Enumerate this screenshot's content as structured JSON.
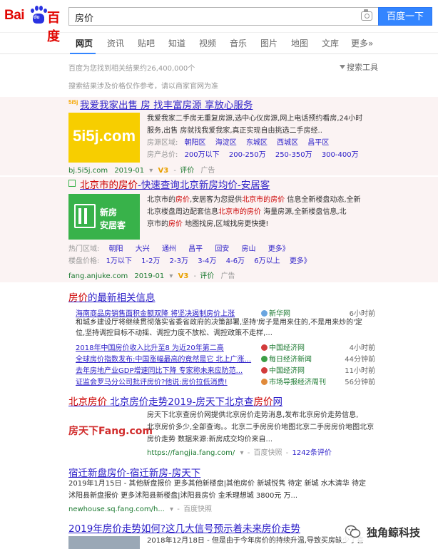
{
  "header": {
    "logo": {
      "bai": "Bai",
      "du": "du",
      "baike": "百度"
    },
    "search_value": "房价",
    "search_button": "百度一下"
  },
  "tabs": [
    "网页",
    "资讯",
    "贴吧",
    "知道",
    "视频",
    "音乐",
    "图片",
    "地图",
    "文库",
    "更多»"
  ],
  "meta": {
    "count": "百度为您找到相关结果约26,400,000个",
    "tools": "搜索工具",
    "notice": "搜索结果涉及价格仅作参考，请以商家官网为准"
  },
  "results": {
    "r1": {
      "title": "我爱我家出售 房 找丰富房源 享放心服务",
      "logo_badge": "5i5j",
      "thumb_text": "5i5j.com",
      "desc1": "我爱我家二手房无重复房源,选中心仪房源,网上电话预约看房,24小时",
      "desc2": "服务,出售 房就找我爱我家,真正实现自由挑选二手房经..",
      "area_label": "房源区域:",
      "areas": [
        "朝阳区",
        "海淀区",
        "东城区",
        "西城区",
        "昌平区"
      ],
      "price_label": "房产总价:",
      "prices": [
        "200万以下",
        "200-250万",
        "250-350万",
        "300-400万"
      ],
      "url": "bj.5i5j.com",
      "date": "2019-01",
      "v3": "V3",
      "comment": "评价",
      "ad": "广告"
    },
    "r2": {
      "title_a": "北京市的",
      "title_b": "房价",
      "title_c": "-快速查询北京新房均价-安居客",
      "thumb_text_1": "新房",
      "thumb_text_2": "安居客",
      "desc1_a": "北京市的",
      "desc1_b": "房价",
      "desc1_c": ",安居客为您提供",
      "desc1_d": "北京市的",
      "desc1_e": "房价",
      "desc1_f": " 信息全新楼盘动态,全新",
      "desc2_a": "北京楼盘周边配套信息",
      "desc2_b": "北京市的",
      "desc2_c": "房价",
      "desc2_d": " 海量房源,全新楼盘信息,北",
      "desc3_a": "京市的",
      "desc3_b": "房价",
      "desc3_c": " 地图找房,区域找房更快捷!",
      "hot_label": "热门区域:",
      "hot": [
        "朝阳",
        "大兴",
        "通州",
        "昌平",
        "回安",
        "房山",
        "更多》"
      ],
      "price_label": "楼盘价格:",
      "prices": [
        "1万以下",
        "1-2万",
        "2-3万",
        "3-4万",
        "4-6万",
        "6万以上",
        "更多》"
      ],
      "url": "fang.anjuke.com",
      "date": "2019-01",
      "v3": "V3",
      "comment": "评价",
      "ad": "广告"
    },
    "news": {
      "title_a": "房价",
      "title_b": "的最新相关信息",
      "row1": {
        "title": "海南商品房销售面积金额双降 将坚决遏制房价上涨",
        "src": "新华网",
        "time": "6小时前"
      },
      "snippet1": "和城乡建设厅将继续贯彻落实省委省政府的决策部署,坚持'房子是用来住的,不是用来炒的'定",
      "snippet2": "位,坚持调控目标不动摇、调控力度不放松、调控政策不走样,...",
      "row2": {
        "title": "2018年中国房价收入比升至8 为近20年第二高",
        "src": "中国经济网",
        "time": "4小时前"
      },
      "row3": {
        "title": "全球房价指数发布:中国涨幅最高的竟然是它 北上广涨...",
        "src": "每日经济新闻",
        "time": "44分钟前"
      },
      "row4": {
        "title": "去年房地产业GDP增速同比下降 专家称未来应防范...",
        "src": "中国经济网",
        "time": "11小时前"
      },
      "row5": {
        "title": "证监会罗马分公司批评房价?他说:房价拉低消费!",
        "src": "市场导报经济周刊",
        "time": "56分钟前"
      }
    },
    "r3": {
      "title_a": "北京房价",
      "title_b": " 北京房价走势2019-房天下北京查",
      "title_c": "房价",
      "title_d": "网",
      "thumb_text": "房天下Fang.com",
      "desc1": "房天下北京查房价网提供北京房价走势消息,发布北京房价走势信息,",
      "desc2": "北京房价多少,全部查询。。北京二手房房价地图北京二手房房价地图北京",
      "desc3": "房价走势 数据来源:新房成交均价来自...",
      "url": "https://fangjia.fang.com/",
      "cache": "百度快照",
      "reviews": "1242条评价"
    },
    "r4": {
      "title": "宿迁新盘房价-宿迁新房-房天下",
      "desc1": "2019年1月15日 - 其他新盘报价 更多其他新楼盘|其他房价 新城悦隽 待定 新城 水木清华 待定",
      "desc2": "沭阳县新盘报价 更多沭阳县新楼盘|沭阳县房价 金禾理想城 3800元 万...",
      "url": "newhouse.sq.fang.com/h...",
      "cache": "百度快照"
    },
    "r5": {
      "title": "2019年房价走势如何?这几大信号预示着未来房价走势",
      "desc1": "2018年12月18日 - 但是由于今年房价的持续升温,导致买房缺少了喜"
    }
  },
  "watermark": "独角鲸科技",
  "colors": {
    "accent": "#3385ff",
    "link": "#2b1ec8",
    "highlight": "#cc0000",
    "url": "#1c7a31",
    "logo_red": "#e10602",
    "logo_blue": "#2932e1"
  }
}
